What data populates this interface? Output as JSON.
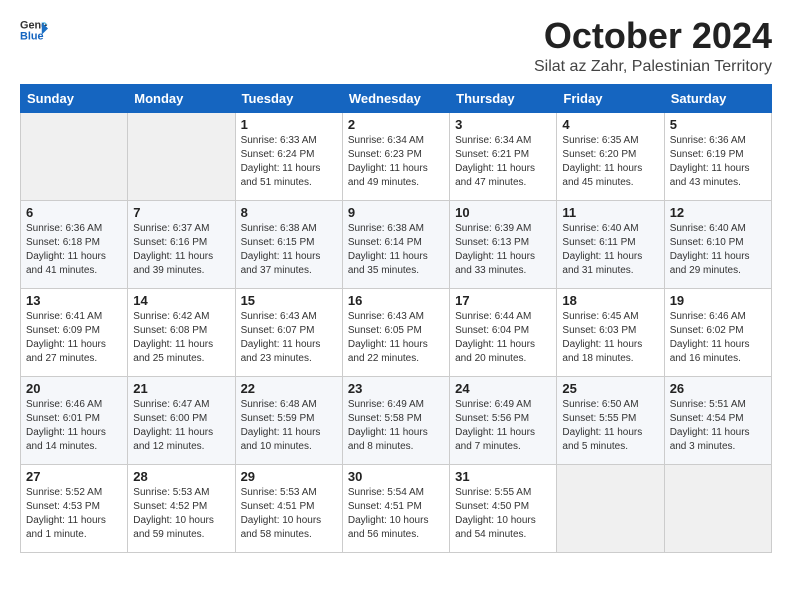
{
  "logo": {
    "general": "General",
    "blue": "Blue"
  },
  "header": {
    "month": "October 2024",
    "location": "Silat az Zahr, Palestinian Territory"
  },
  "days_of_week": [
    "Sunday",
    "Monday",
    "Tuesday",
    "Wednesday",
    "Thursday",
    "Friday",
    "Saturday"
  ],
  "weeks": [
    [
      {
        "day": "",
        "info": ""
      },
      {
        "day": "",
        "info": ""
      },
      {
        "day": "1",
        "info": "Sunrise: 6:33 AM\nSunset: 6:24 PM\nDaylight: 11 hours and 51 minutes."
      },
      {
        "day": "2",
        "info": "Sunrise: 6:34 AM\nSunset: 6:23 PM\nDaylight: 11 hours and 49 minutes."
      },
      {
        "day": "3",
        "info": "Sunrise: 6:34 AM\nSunset: 6:21 PM\nDaylight: 11 hours and 47 minutes."
      },
      {
        "day": "4",
        "info": "Sunrise: 6:35 AM\nSunset: 6:20 PM\nDaylight: 11 hours and 45 minutes."
      },
      {
        "day": "5",
        "info": "Sunrise: 6:36 AM\nSunset: 6:19 PM\nDaylight: 11 hours and 43 minutes."
      }
    ],
    [
      {
        "day": "6",
        "info": "Sunrise: 6:36 AM\nSunset: 6:18 PM\nDaylight: 11 hours and 41 minutes."
      },
      {
        "day": "7",
        "info": "Sunrise: 6:37 AM\nSunset: 6:16 PM\nDaylight: 11 hours and 39 minutes."
      },
      {
        "day": "8",
        "info": "Sunrise: 6:38 AM\nSunset: 6:15 PM\nDaylight: 11 hours and 37 minutes."
      },
      {
        "day": "9",
        "info": "Sunrise: 6:38 AM\nSunset: 6:14 PM\nDaylight: 11 hours and 35 minutes."
      },
      {
        "day": "10",
        "info": "Sunrise: 6:39 AM\nSunset: 6:13 PM\nDaylight: 11 hours and 33 minutes."
      },
      {
        "day": "11",
        "info": "Sunrise: 6:40 AM\nSunset: 6:11 PM\nDaylight: 11 hours and 31 minutes."
      },
      {
        "day": "12",
        "info": "Sunrise: 6:40 AM\nSunset: 6:10 PM\nDaylight: 11 hours and 29 minutes."
      }
    ],
    [
      {
        "day": "13",
        "info": "Sunrise: 6:41 AM\nSunset: 6:09 PM\nDaylight: 11 hours and 27 minutes."
      },
      {
        "day": "14",
        "info": "Sunrise: 6:42 AM\nSunset: 6:08 PM\nDaylight: 11 hours and 25 minutes."
      },
      {
        "day": "15",
        "info": "Sunrise: 6:43 AM\nSunset: 6:07 PM\nDaylight: 11 hours and 23 minutes."
      },
      {
        "day": "16",
        "info": "Sunrise: 6:43 AM\nSunset: 6:05 PM\nDaylight: 11 hours and 22 minutes."
      },
      {
        "day": "17",
        "info": "Sunrise: 6:44 AM\nSunset: 6:04 PM\nDaylight: 11 hours and 20 minutes."
      },
      {
        "day": "18",
        "info": "Sunrise: 6:45 AM\nSunset: 6:03 PM\nDaylight: 11 hours and 18 minutes."
      },
      {
        "day": "19",
        "info": "Sunrise: 6:46 AM\nSunset: 6:02 PM\nDaylight: 11 hours and 16 minutes."
      }
    ],
    [
      {
        "day": "20",
        "info": "Sunrise: 6:46 AM\nSunset: 6:01 PM\nDaylight: 11 hours and 14 minutes."
      },
      {
        "day": "21",
        "info": "Sunrise: 6:47 AM\nSunset: 6:00 PM\nDaylight: 11 hours and 12 minutes."
      },
      {
        "day": "22",
        "info": "Sunrise: 6:48 AM\nSunset: 5:59 PM\nDaylight: 11 hours and 10 minutes."
      },
      {
        "day": "23",
        "info": "Sunrise: 6:49 AM\nSunset: 5:58 PM\nDaylight: 11 hours and 8 minutes."
      },
      {
        "day": "24",
        "info": "Sunrise: 6:49 AM\nSunset: 5:56 PM\nDaylight: 11 hours and 7 minutes."
      },
      {
        "day": "25",
        "info": "Sunrise: 6:50 AM\nSunset: 5:55 PM\nDaylight: 11 hours and 5 minutes."
      },
      {
        "day": "26",
        "info": "Sunrise: 5:51 AM\nSunset: 4:54 PM\nDaylight: 11 hours and 3 minutes."
      }
    ],
    [
      {
        "day": "27",
        "info": "Sunrise: 5:52 AM\nSunset: 4:53 PM\nDaylight: 11 hours and 1 minute."
      },
      {
        "day": "28",
        "info": "Sunrise: 5:53 AM\nSunset: 4:52 PM\nDaylight: 10 hours and 59 minutes."
      },
      {
        "day": "29",
        "info": "Sunrise: 5:53 AM\nSunset: 4:51 PM\nDaylight: 10 hours and 58 minutes."
      },
      {
        "day": "30",
        "info": "Sunrise: 5:54 AM\nSunset: 4:51 PM\nDaylight: 10 hours and 56 minutes."
      },
      {
        "day": "31",
        "info": "Sunrise: 5:55 AM\nSunset: 4:50 PM\nDaylight: 10 hours and 54 minutes."
      },
      {
        "day": "",
        "info": ""
      },
      {
        "day": "",
        "info": ""
      }
    ]
  ]
}
